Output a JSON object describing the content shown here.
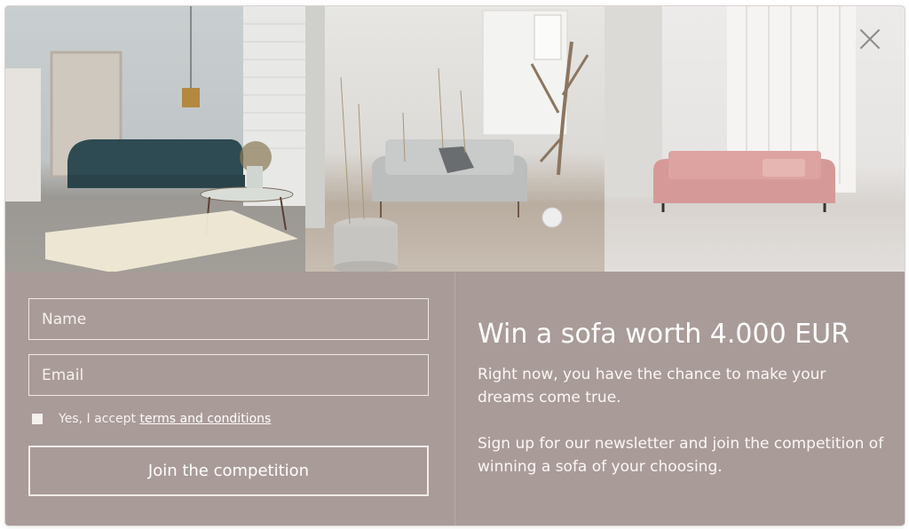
{
  "colors": {
    "panel_background": "#a99b98",
    "text": "#ffffff",
    "field_border": "#efe9e8"
  },
  "images": [
    {
      "icon": "living-room-teal-sofa-image"
    },
    {
      "icon": "living-room-grey-sofa-image"
    },
    {
      "icon": "living-room-pink-sofa-image"
    }
  ],
  "close": {
    "icon": "close-icon"
  },
  "form": {
    "name_placeholder": "Name",
    "email_placeholder": "Email",
    "consent_prefix": "Yes, I accept",
    "terms_link": "terms and conditions",
    "submit_label": "Join the competition"
  },
  "copy": {
    "headline": "Win a sofa worth 4.000 EUR",
    "paragraph1": "Right now, you have the chance to make your dreams come true.",
    "paragraph2": "Sign up for our newsletter and join the competition of winning a sofa of your choosing."
  }
}
